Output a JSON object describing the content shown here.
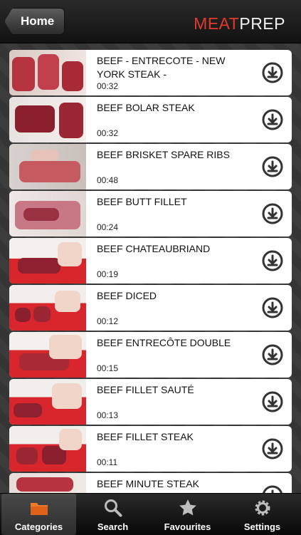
{
  "nav": {
    "back_label": "Home",
    "logo_meat": "MEAT",
    "logo_prep": "PREP"
  },
  "items": [
    {
      "title": "BEEF - ENTRECOTE - NEW YORK STEAK -",
      "duration": "00:32"
    },
    {
      "title": "BEEF BOLAR STEAK",
      "duration": "00:32"
    },
    {
      "title": "BEEF BRISKET SPARE RIBS",
      "duration": "00:48"
    },
    {
      "title": "BEEF BUTT FILLET",
      "duration": "00:24"
    },
    {
      "title": "BEEF CHATEAUBRIAND",
      "duration": "00:19"
    },
    {
      "title": "BEEF DICED",
      "duration": "00:12"
    },
    {
      "title": "BEEF ENTRECÔTE DOUBLE",
      "duration": "00:15"
    },
    {
      "title": "BEEF FILLET SAUTÉ",
      "duration": "00:13"
    },
    {
      "title": "BEEF FILLET STEAK",
      "duration": "00:11"
    },
    {
      "title": "BEEF MINUTE STEAK",
      "duration": ""
    }
  ],
  "tabs": [
    {
      "label": "Categories",
      "icon": "folder-icon",
      "active": true
    },
    {
      "label": "Search",
      "icon": "search-icon",
      "active": false
    },
    {
      "label": "Favourites",
      "icon": "star-icon",
      "active": false
    },
    {
      "label": "Settings",
      "icon": "gear-icon",
      "active": false
    }
  ],
  "colors": {
    "accent": "#e23b2a",
    "tab_active_icon": "#f07a2a"
  }
}
